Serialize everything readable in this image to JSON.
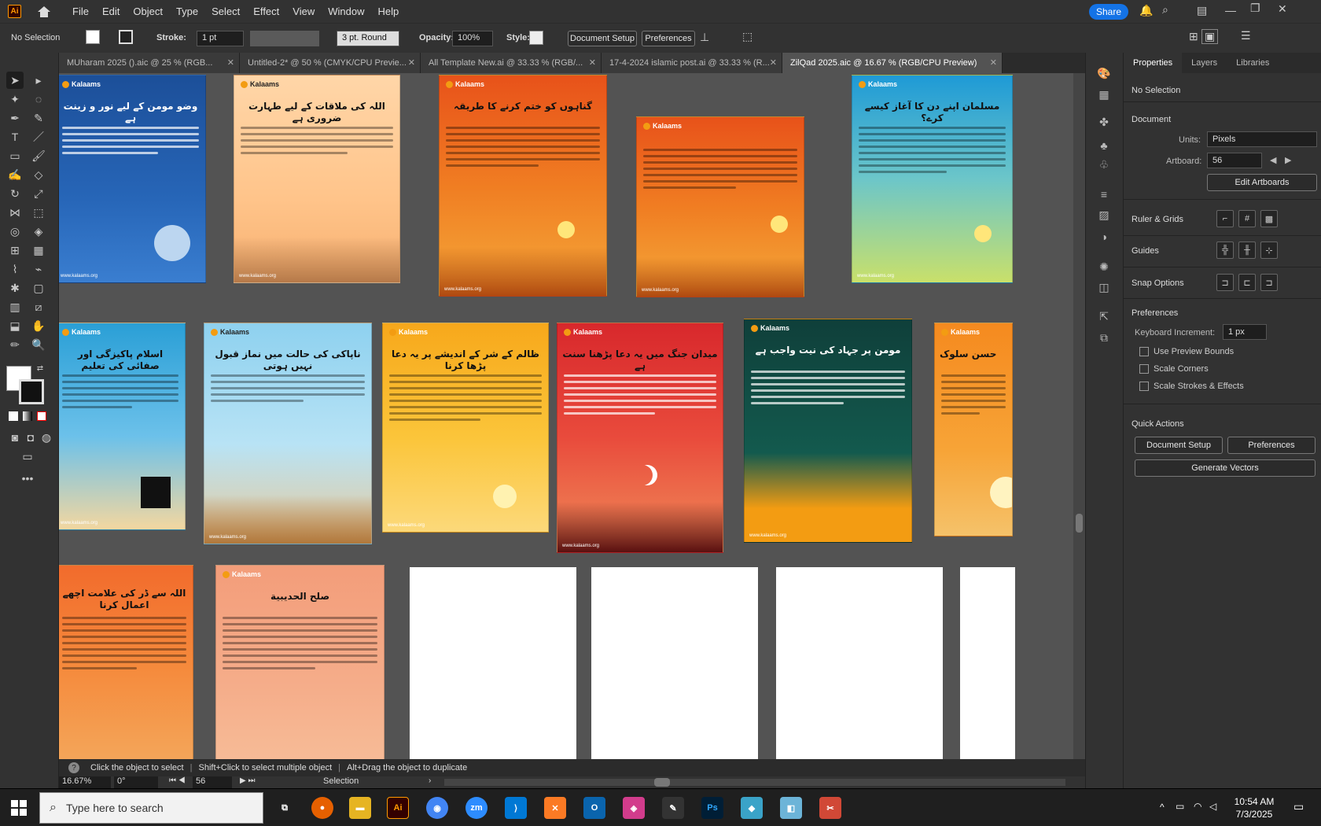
{
  "menubar": {
    "app_logo": "Ai",
    "items": [
      "File",
      "Edit",
      "Object",
      "Type",
      "Select",
      "Effect",
      "View",
      "Window",
      "Help"
    ],
    "share_label": "Share"
  },
  "control_bar": {
    "selection": "No Selection",
    "stroke_label": "Stroke:",
    "stroke_value": "1 pt",
    "brush_value": "3 pt. Round",
    "opacity_label": "Opacity:",
    "opacity_value": "100%",
    "style_label": "Style:",
    "document_setup": "Document Setup",
    "preferences": "Preferences"
  },
  "tabs": [
    {
      "label": "MUharam 2025 ().aic @ 25 % (RGB..."
    },
    {
      "label": "Untitled-2* @ 50 % (CMYK/CPU Previe..."
    },
    {
      "label": "All Template New.ai @ 33.33 % (RGB/..."
    },
    {
      "label": "17-4-2024 islamic post.ai @ 33.33 % (R..."
    },
    {
      "label": "ZilQad 2025.aic @ 16.67 % (RGB/CPU Preview)"
    }
  ],
  "artboards": [
    {
      "title": "وضو مومن کے لیے نور و زینت ہے"
    },
    {
      "title": "اللہ کی ملاقات کے لیے طہارت ضروری ہے"
    },
    {
      "title": "گناہوں کو ختم کرنے کا طریقہ"
    },
    {
      "title": ""
    },
    {
      "title": "مسلمان اپنے دن کا آغاز کیسے کرے؟"
    },
    {
      "title": "اسلام پاکیزگی اور صفائی کی تعلیم"
    },
    {
      "title": "ناپاکی کی حالت میں نماز قبول نہیں ہوتی"
    },
    {
      "title": "ظالم کے شر کے اندیشے پر یہ دعا پڑھا کرنا"
    },
    {
      "title": "میدان جنگ میں یہ دعا پڑھنا سنت ہے"
    },
    {
      "title": "مومن پر جہاد کی نیت واجب ہے"
    },
    {
      "title": "حسن سلوک"
    },
    {
      "title": "اللہ سے ڈر کی علامت اچھے اعمال کرنا"
    },
    {
      "title": "صلح الحديبية"
    }
  ],
  "artboard_brand": "Kalaams",
  "artboard_url": "www.kalaams.org",
  "panel": {
    "tabs": [
      "Properties",
      "Layers",
      "Libraries"
    ],
    "selection": "No Selection",
    "document_heading": "Document",
    "units_label": "Units:",
    "units_value": "Pixels",
    "artboard_label": "Artboard:",
    "artboard_value": "56",
    "edit_artboards": "Edit Artboards",
    "rulers_grids": "Ruler & Grids",
    "guides": "Guides",
    "snap_options": "Snap Options",
    "preferences_heading": "Preferences",
    "keyboard_increment_label": "Keyboard Increment:",
    "keyboard_increment_value": "1 px",
    "checkboxes": [
      "Use Preview Bounds",
      "Scale Corners",
      "Scale Strokes & Effects"
    ],
    "quick_actions": "Quick Actions",
    "document_setup": "Document Setup",
    "preferences": "Preferences",
    "generate_vectors": "Generate Vectors"
  },
  "hint_bar": {
    "text1": "Click the object to select",
    "text2": "Shift+Click to select multiple object",
    "text3": "Alt+Drag the object to duplicate"
  },
  "status": {
    "zoom": "16.67%",
    "rotation": "0°",
    "artboard": "56",
    "mode": "Selection"
  },
  "taskbar": {
    "search_placeholder": "Type here to search",
    "time": "10:54 AM",
    "date": "7/3/2025"
  }
}
